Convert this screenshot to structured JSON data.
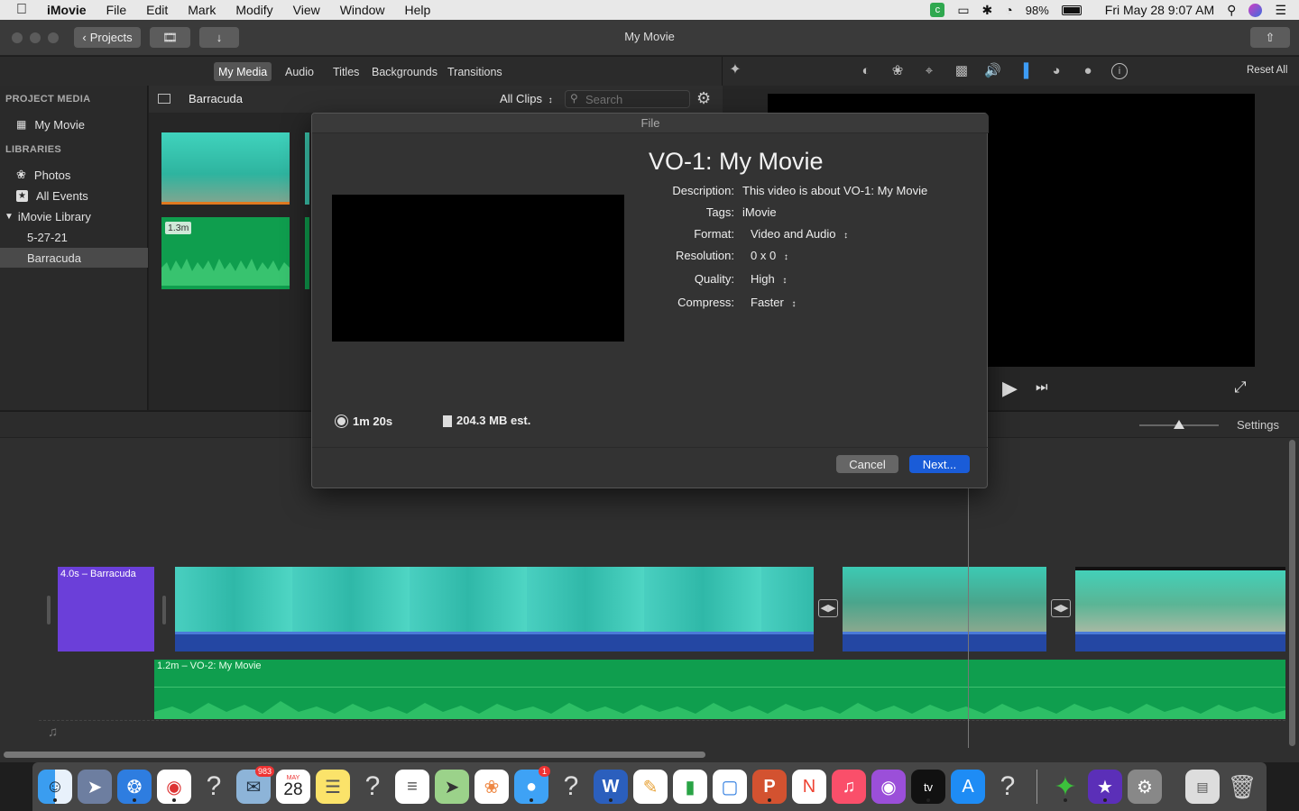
{
  "menubar": {
    "apple": "",
    "app_name": "iMovie",
    "items": [
      "File",
      "Edit",
      "Mark",
      "Modify",
      "View",
      "Window",
      "Help"
    ],
    "battery": "98%",
    "clock": "Fri May 28  9:07 AM"
  },
  "toolbar": {
    "projects_label": "Projects",
    "window_title": "My Movie",
    "share_icon": "share-icon"
  },
  "tabs": [
    "My Media",
    "Audio",
    "Titles",
    "Backgrounds",
    "Transitions"
  ],
  "active_tab": "My Media",
  "viewer_controls": {
    "reset_all": "Reset All"
  },
  "sidebar": {
    "project_media_header": "PROJECT MEDIA",
    "project_item": "My Movie",
    "libraries_header": "LIBRARIES",
    "library_items": [
      {
        "label": "Photos",
        "icon": "photos-icon"
      },
      {
        "label": "All Events",
        "icon": "star-icon"
      },
      {
        "label": "iMovie Library",
        "icon": "disclosure-triangle-icon"
      },
      {
        "label": "5-27-21",
        "icon": ""
      },
      {
        "label": "Barracuda",
        "icon": ""
      }
    ],
    "selected": "Barracuda"
  },
  "browser": {
    "event_title": "Barracuda",
    "filter": "All Clips",
    "search_placeholder": "Search",
    "clip_badge": "1.3m"
  },
  "dialog": {
    "window_title": "File",
    "title": "VO-1: My Movie",
    "fields": [
      {
        "label": "Description:",
        "value": "This video is about VO-1: My Movie"
      },
      {
        "label": "Tags:",
        "value": "iMovie"
      },
      {
        "label": "Format:",
        "value": "Video and Audio"
      },
      {
        "label": "Resolution:",
        "value": "0 x 0"
      },
      {
        "label": "Quality:",
        "value": "High"
      },
      {
        "label": "Compress:",
        "value": "Faster"
      }
    ],
    "duration": "1m 20s",
    "size": "204.3 MB est.",
    "cancel": "Cancel",
    "next": "Next..."
  },
  "timeline": {
    "settings": "Settings",
    "title_clip": "4.0s – Barracuda",
    "audio_clip": "1.2m – VO-2: My Movie"
  },
  "dock": {
    "mail_badge": "983",
    "calendar_month": "MAY",
    "calendar_day": "28",
    "messages_badge": "1"
  },
  "colors": {
    "accent_blue": "#1a5cd8",
    "audio_green": "#0f9e4e",
    "title_purple": "#6b3fd9",
    "water": "#3cc9b0"
  }
}
